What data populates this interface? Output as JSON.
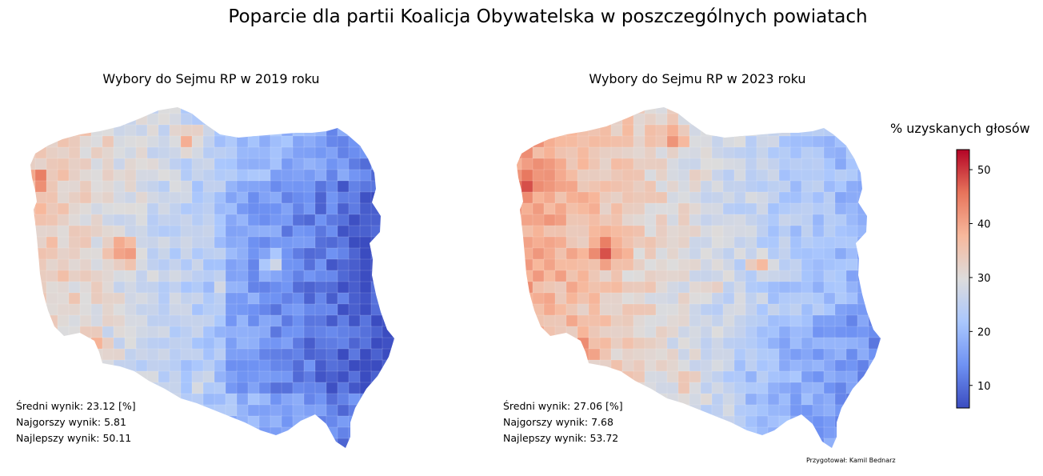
{
  "title": "Poparcie dla partii Koalicja Obywatelska w poszczególnych powiatach",
  "maps": [
    {
      "title": "Wybory do Sejmu RP w 2019 roku",
      "stats": [
        "Średni wynik: 23.12 [%]",
        "Najgorszy wynik: 5.81",
        "Najlepszy wynik: 50.11"
      ]
    },
    {
      "title": "Wybory do Sejmu RP w 2023 roku",
      "stats": [
        "Średni wynik: 27.06 [%]",
        "Najgorszy wynik: 7.68",
        "Najlepszy wynik: 53.72"
      ]
    }
  ],
  "colorbar": {
    "label": "% uzyskanych głosów",
    "min": 5.81,
    "max": 53.72,
    "ticks": [
      "10",
      "20",
      "30",
      "40",
      "50"
    ],
    "colormap": "coolwarm",
    "colors": [
      "#3b4cc0",
      "#6f92f3",
      "#aac7fd",
      "#dddcdc",
      "#f7b89c",
      "#e7745b",
      "#b40426"
    ]
  },
  "credit": "Przygotował: Kamil Bednarz"
}
